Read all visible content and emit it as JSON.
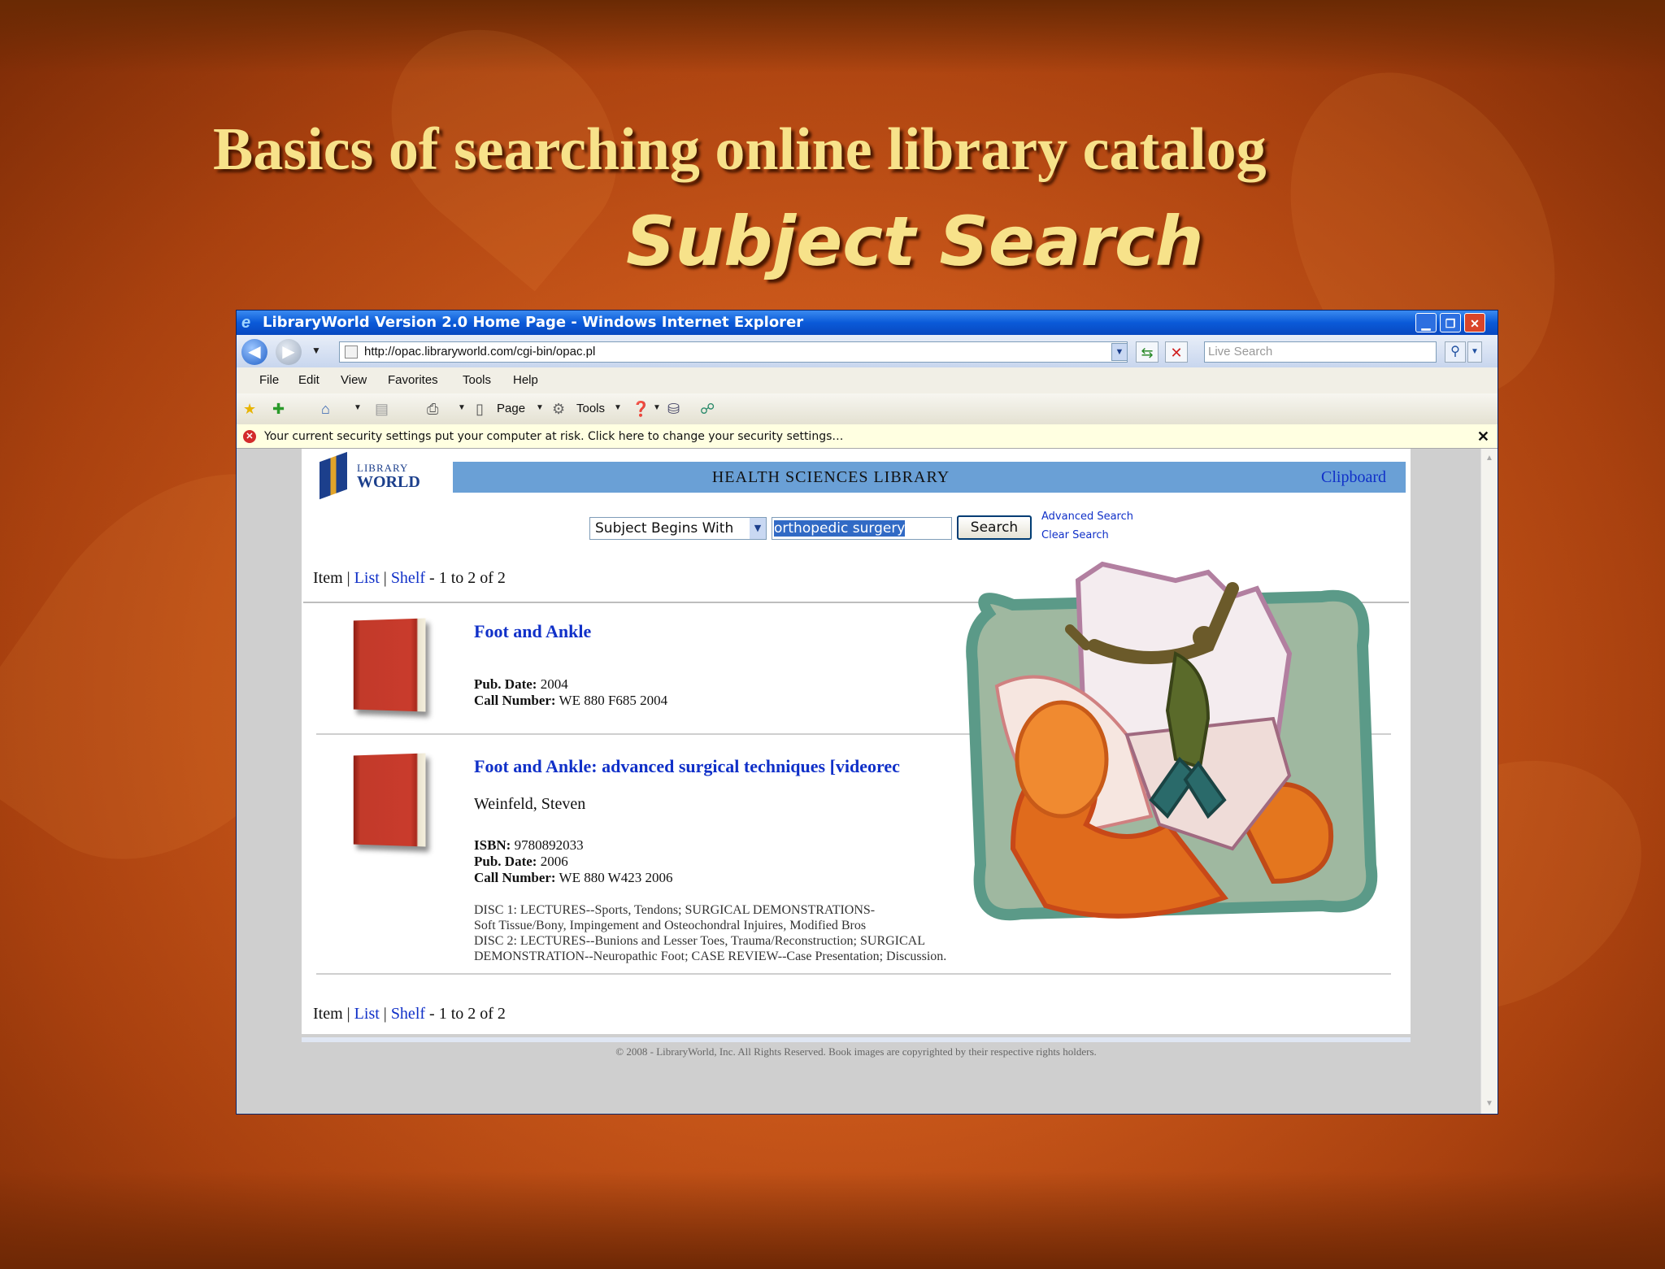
{
  "slide": {
    "title": "Basics of searching online library catalog",
    "subtitle": "Subject Search"
  },
  "browser": {
    "window_title": "LibraryWorld Version 2.0 Home Page - Windows Internet Explorer",
    "url": "http://opac.libraryworld.com/cgi-bin/opac.pl",
    "live_search_placeholder": "Live Search",
    "menu": [
      "File",
      "Edit",
      "View",
      "Favorites",
      "Tools",
      "Help"
    ],
    "toolbar": {
      "page_label": "Page",
      "tools_label": "Tools"
    },
    "infobar_message": "Your current security settings put your computer at risk. Click here to change your security settings…",
    "infobar_close": "✕"
  },
  "library": {
    "logo_top": "LIBRARY",
    "logo_bottom": "WORLD",
    "header_title": "HEALTH SCIENCES LIBRARY",
    "clipboard_link": "Clipboard",
    "search": {
      "mode": "Subject Begins With",
      "query": "orthopedic surgery",
      "button": "Search",
      "advanced": "Advanced Search",
      "clear": "Clear Search"
    },
    "pager": {
      "item": "Item",
      "sep": "|",
      "list": "List",
      "shelf": "Shelf",
      "range": "- 1 to 2 of 2"
    },
    "results": [
      {
        "title": "Foot and Ankle",
        "pub_date_label": "Pub. Date:",
        "pub_date": "2004",
        "call_number_label": "Call Number:",
        "call_number": "WE 880 F685 2004"
      },
      {
        "title": "Foot and Ankle: advanced surgical techniques [videorec",
        "author": "Weinfeld, Steven",
        "isbn_label": "ISBN:",
        "isbn": "9780892033",
        "pub_date_label": "Pub. Date:",
        "pub_date": "2006",
        "call_number_label": "Call Number:",
        "call_number": "WE 880 W423 2006",
        "notes": [
          "DISC 1: LECTURES--Sports, Tendons; SURGICAL DEMONSTRATIONS-",
          "Soft Tissue/Bony, Impingement and Osteochondral Injuires, Modified Bros",
          "DISC 2: LECTURES--Bunions and Lesser Toes, Trauma/Reconstruction; SURGICAL",
          "DEMONSTRATION--Neuropathic Foot; CASE REVIEW--Case Presentation; Discussion."
        ]
      }
    ],
    "copyright": "© 2008 - LibraryWorld, Inc. All Rights Reserved. Book images are copyrighted by their respective rights holders."
  }
}
